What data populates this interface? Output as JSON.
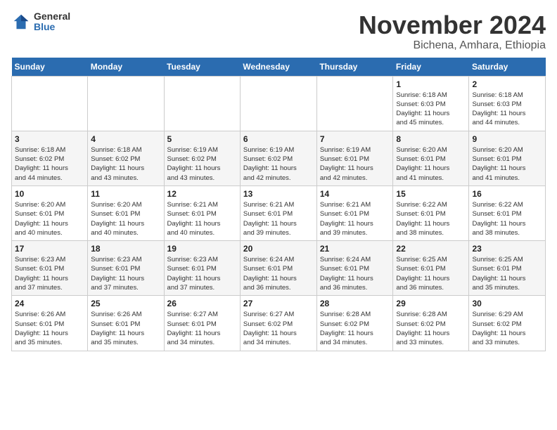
{
  "logo": {
    "general": "General",
    "blue": "Blue"
  },
  "title": "November 2024",
  "subtitle": "Bichena, Amhara, Ethiopia",
  "days_of_week": [
    "Sunday",
    "Monday",
    "Tuesday",
    "Wednesday",
    "Thursday",
    "Friday",
    "Saturday"
  ],
  "weeks": [
    [
      {
        "day": "",
        "info": ""
      },
      {
        "day": "",
        "info": ""
      },
      {
        "day": "",
        "info": ""
      },
      {
        "day": "",
        "info": ""
      },
      {
        "day": "",
        "info": ""
      },
      {
        "day": "1",
        "info": "Sunrise: 6:18 AM\nSunset: 6:03 PM\nDaylight: 11 hours\nand 45 minutes."
      },
      {
        "day": "2",
        "info": "Sunrise: 6:18 AM\nSunset: 6:03 PM\nDaylight: 11 hours\nand 44 minutes."
      }
    ],
    [
      {
        "day": "3",
        "info": "Sunrise: 6:18 AM\nSunset: 6:02 PM\nDaylight: 11 hours\nand 44 minutes."
      },
      {
        "day": "4",
        "info": "Sunrise: 6:18 AM\nSunset: 6:02 PM\nDaylight: 11 hours\nand 43 minutes."
      },
      {
        "day": "5",
        "info": "Sunrise: 6:19 AM\nSunset: 6:02 PM\nDaylight: 11 hours\nand 43 minutes."
      },
      {
        "day": "6",
        "info": "Sunrise: 6:19 AM\nSunset: 6:02 PM\nDaylight: 11 hours\nand 42 minutes."
      },
      {
        "day": "7",
        "info": "Sunrise: 6:19 AM\nSunset: 6:01 PM\nDaylight: 11 hours\nand 42 minutes."
      },
      {
        "day": "8",
        "info": "Sunrise: 6:20 AM\nSunset: 6:01 PM\nDaylight: 11 hours\nand 41 minutes."
      },
      {
        "day": "9",
        "info": "Sunrise: 6:20 AM\nSunset: 6:01 PM\nDaylight: 11 hours\nand 41 minutes."
      }
    ],
    [
      {
        "day": "10",
        "info": "Sunrise: 6:20 AM\nSunset: 6:01 PM\nDaylight: 11 hours\nand 40 minutes."
      },
      {
        "day": "11",
        "info": "Sunrise: 6:20 AM\nSunset: 6:01 PM\nDaylight: 11 hours\nand 40 minutes."
      },
      {
        "day": "12",
        "info": "Sunrise: 6:21 AM\nSunset: 6:01 PM\nDaylight: 11 hours\nand 40 minutes."
      },
      {
        "day": "13",
        "info": "Sunrise: 6:21 AM\nSunset: 6:01 PM\nDaylight: 11 hours\nand 39 minutes."
      },
      {
        "day": "14",
        "info": "Sunrise: 6:21 AM\nSunset: 6:01 PM\nDaylight: 11 hours\nand 39 minutes."
      },
      {
        "day": "15",
        "info": "Sunrise: 6:22 AM\nSunset: 6:01 PM\nDaylight: 11 hours\nand 38 minutes."
      },
      {
        "day": "16",
        "info": "Sunrise: 6:22 AM\nSunset: 6:01 PM\nDaylight: 11 hours\nand 38 minutes."
      }
    ],
    [
      {
        "day": "17",
        "info": "Sunrise: 6:23 AM\nSunset: 6:01 PM\nDaylight: 11 hours\nand 37 minutes."
      },
      {
        "day": "18",
        "info": "Sunrise: 6:23 AM\nSunset: 6:01 PM\nDaylight: 11 hours\nand 37 minutes."
      },
      {
        "day": "19",
        "info": "Sunrise: 6:23 AM\nSunset: 6:01 PM\nDaylight: 11 hours\nand 37 minutes."
      },
      {
        "day": "20",
        "info": "Sunrise: 6:24 AM\nSunset: 6:01 PM\nDaylight: 11 hours\nand 36 minutes."
      },
      {
        "day": "21",
        "info": "Sunrise: 6:24 AM\nSunset: 6:01 PM\nDaylight: 11 hours\nand 36 minutes."
      },
      {
        "day": "22",
        "info": "Sunrise: 6:25 AM\nSunset: 6:01 PM\nDaylight: 11 hours\nand 36 minutes."
      },
      {
        "day": "23",
        "info": "Sunrise: 6:25 AM\nSunset: 6:01 PM\nDaylight: 11 hours\nand 35 minutes."
      }
    ],
    [
      {
        "day": "24",
        "info": "Sunrise: 6:26 AM\nSunset: 6:01 PM\nDaylight: 11 hours\nand 35 minutes."
      },
      {
        "day": "25",
        "info": "Sunrise: 6:26 AM\nSunset: 6:01 PM\nDaylight: 11 hours\nand 35 minutes."
      },
      {
        "day": "26",
        "info": "Sunrise: 6:27 AM\nSunset: 6:01 PM\nDaylight: 11 hours\nand 34 minutes."
      },
      {
        "day": "27",
        "info": "Sunrise: 6:27 AM\nSunset: 6:02 PM\nDaylight: 11 hours\nand 34 minutes."
      },
      {
        "day": "28",
        "info": "Sunrise: 6:28 AM\nSunset: 6:02 PM\nDaylight: 11 hours\nand 34 minutes."
      },
      {
        "day": "29",
        "info": "Sunrise: 6:28 AM\nSunset: 6:02 PM\nDaylight: 11 hours\nand 33 minutes."
      },
      {
        "day": "30",
        "info": "Sunrise: 6:29 AM\nSunset: 6:02 PM\nDaylight: 11 hours\nand 33 minutes."
      }
    ]
  ]
}
